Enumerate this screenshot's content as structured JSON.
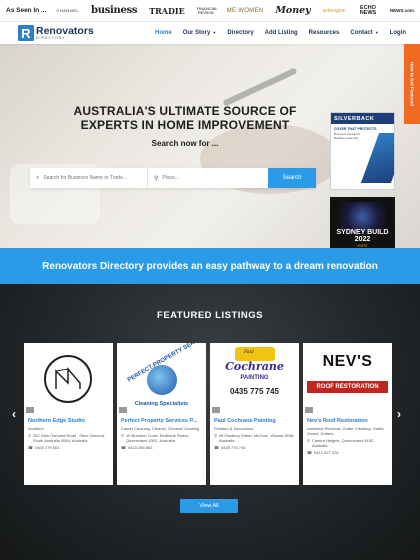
{
  "seen_in": {
    "label": "As Seen In ...",
    "logos": [
      "CHANNEL",
      "business",
      "TRADIE",
      "FINANCIAL REVIEW",
      "ME WOMEN",
      "Money",
      "actiongear",
      "ECHO NEWS",
      "NEWS.com"
    ]
  },
  "brand": {
    "name": "Renovators",
    "subtitle": "DIRECTORY",
    "mark": "R",
    "color": "#2f7fc8"
  },
  "nav": {
    "items": [
      {
        "label": "Home",
        "active": true,
        "dropdown": false
      },
      {
        "label": "Our Story",
        "active": false,
        "dropdown": true
      },
      {
        "label": "Directory",
        "active": false,
        "dropdown": false
      },
      {
        "label": "Add Listing",
        "active": false,
        "dropdown": false
      },
      {
        "label": "Resources",
        "active": false,
        "dropdown": false
      },
      {
        "label": "Contact",
        "active": false,
        "dropdown": true
      },
      {
        "label": "Login",
        "active": false,
        "dropdown": false
      }
    ]
  },
  "hero": {
    "title": "AUSTRALIA'S ULTIMATE SOURCE OF EXPERTS IN HOME IMPROVEMENT",
    "subtitle": "Search now for ...",
    "search": {
      "keyword_placeholder": "Search for Business Name or Trade...",
      "place_placeholder": "Place...",
      "button_label": "Search"
    }
  },
  "ads": {
    "ad1": {
      "brand": "SILVERBACK",
      "headline": "COVER THAT PROTECTS",
      "bullets": [
        "Business Insurance",
        "Builders Indemnity"
      ]
    },
    "ad2": {
      "title": "SYDNEY BUILD 2022",
      "sub": "EXPO"
    }
  },
  "side_tab": {
    "label": "How to Get Featured"
  },
  "banner": {
    "text": "Renovators Directory provides an easy pathway to a dream renovation"
  },
  "featured": {
    "title": "FEATURED LISTINGS",
    "view_all_label": "View All",
    "listings": [
      {
        "name": "Northern Edge Studio",
        "category": "Architect",
        "address": "202 Glen Osmond Road , Glen Osmond, South Australia 5064, Australia",
        "phone": "0400 279 604"
      },
      {
        "name": "Perfect Property Services P...",
        "category": "Carpet Cleaning, Cleaner, General Cleaning",
        "address": "10 Brandon Court, Redbank Plains, Queensland 4301, Australia",
        "phone": "0423 285 863"
      },
      {
        "name": "Paul Cochrane Painting",
        "category": "Painters & Decorators",
        "address": "58 Finsbury Street, McCrae, Victoria 3938, Australia",
        "phone": "0435 775 745"
      },
      {
        "name": "Nev's Roof Restoration",
        "category": "Asbestos Removal, Gutter Cleaning, Gutter Guard, Gutters",
        "address": "Camira Heights, Queensland 4152, Australia",
        "phone": "0412 527 378"
      }
    ],
    "logos": {
      "perfect_arc": "PERFECT PROPERTY SERVICES PTY",
      "perfect_sub": "Cleaning Specialists",
      "paul_top": "Paul",
      "paul_main": "Cochrane",
      "paul_word": "PAINTING",
      "paul_phone": "0435 775 745",
      "nev_main": "NEV'S",
      "nev_sub": "ROOF RESTORATION"
    }
  },
  "colors": {
    "accent": "#2b9be8",
    "side_tab": "#f26a21",
    "navy": "#1d3557"
  }
}
